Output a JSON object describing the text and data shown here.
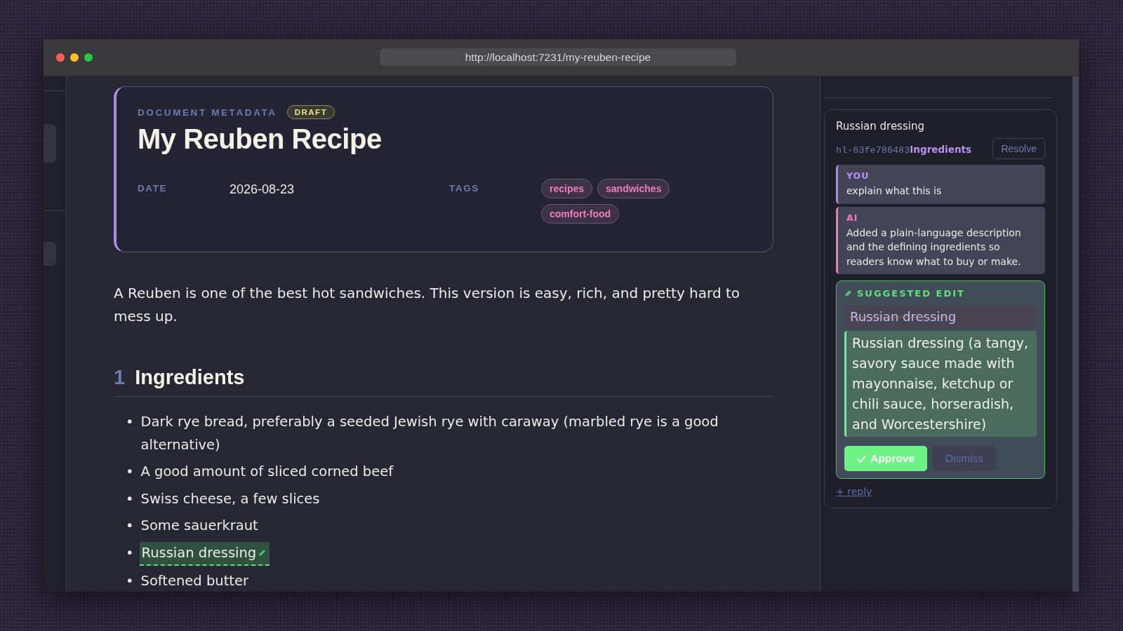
{
  "browser": {
    "url": "http://localhost:7231/my-reuben-recipe"
  },
  "metadata": {
    "section_label": "DOCUMENT METADATA",
    "status_badge": "DRAFT",
    "title": "My Reuben Recipe",
    "fields": [
      {
        "kind": "text",
        "label": "DATE",
        "value": "2026-08-23"
      },
      {
        "kind": "tags",
        "label": "TAGS",
        "tags": [
          "recipes",
          "sandwiches",
          "comfort-food"
        ]
      }
    ]
  },
  "intro": "A Reuben is one of the best hot sandwiches. This version is easy, rich, and pretty hard to mess up.",
  "sections": [
    {
      "number": "1",
      "heading": "Ingredients",
      "marker": "•",
      "items": [
        {
          "text": "Dark rye bread, preferably a seeded Jewish rye with caraway (marbled rye is a good alternative)",
          "highlighted": false
        },
        {
          "text": "A good amount of sliced corned beef",
          "highlighted": false
        },
        {
          "text": "Swiss cheese, a few slices",
          "highlighted": false
        },
        {
          "text": "Some sauerkraut",
          "highlighted": false
        },
        {
          "text": "Russian dressing",
          "highlighted": true
        },
        {
          "text": "Softened butter",
          "highlighted": false
        }
      ]
    }
  ],
  "highlight_card": {
    "quote": "Russian dressing",
    "id": "hl-63fe786483",
    "section": "Ingredients",
    "resolve_button": "Resolve",
    "messages": [
      {
        "kind": "user",
        "author": "YOU",
        "text": "explain what this is"
      },
      {
        "kind": "ai",
        "author": "AI",
        "text": "Added a plain-language description and the defining ingredients so readers know what to buy or make."
      }
    ],
    "suggestion": {
      "label": "SUGGESTED EDIT",
      "removed": "Russian dressing",
      "added": "Russian dressing (a tangy, savory sauce made with mayonnaise, ketchup or chili sauce, horseradish, and Worcestershire)",
      "approve_button": "Approve",
      "dismiss_button": "Dismiss"
    },
    "reply_link": "+ reply"
  }
}
